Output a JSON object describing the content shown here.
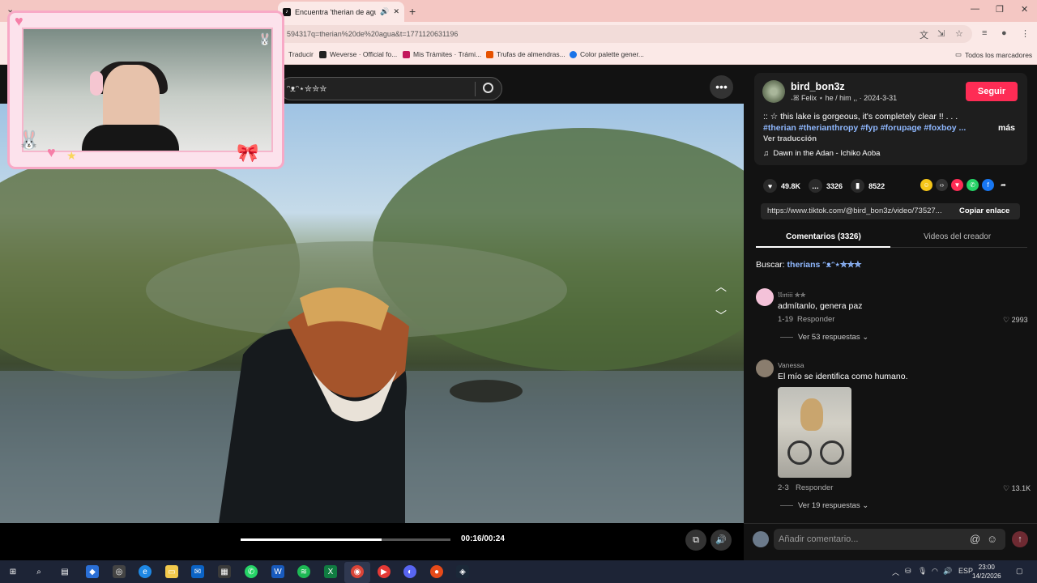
{
  "browser": {
    "active_tab_title": "Encuentra 'therian de agua'",
    "url": "594317q=therian%20de%20agua&t=1771120631196",
    "new_tab": "+",
    "bookmarks": [
      {
        "label": "Traducir",
        "color": "#4285f4"
      },
      {
        "label": "Weverse · Official fo...",
        "color": "#222222"
      },
      {
        "label": "Mis Trámites · Trámi...",
        "color": "#c2185b"
      },
      {
        "label": "Trufas de almendras...",
        "color": "#e65100"
      },
      {
        "label": "Color palette gener...",
        "color": "#1a73e8"
      }
    ],
    "bookmarks_all": "Todos los marcadores"
  },
  "tiktok": {
    "search_value": "ᵔᴥᵔ⋆✮✮✮",
    "video": {
      "time": "00:16/00:24",
      "progress_fraction": 0.67
    },
    "author": {
      "username": "bird_bon3z",
      "subtitle": "˖ꕤ Felix ⋆ he / him ,, · 2024-3-31",
      "follow_label": "Seguir",
      "description": ":: ☆ this lake is gorgeous, it's completely clear !! . . .",
      "hashtags": "#therian #therianthropy #fyp #forupage #foxboy ...",
      "more_label": "más",
      "translate_label": "Ver traducción",
      "music": "Dawn in the Adan - Ichiko Aoba"
    },
    "stats": {
      "likes": "49.8K",
      "comments": "3326",
      "saves": "8522"
    },
    "share_link": "https://www.tiktok.com/@bird_bon3z/video/73527...",
    "copy_link_label": "Copiar enlace",
    "tabs": {
      "comments": "Comentarios (3326)",
      "creator_videos": "Videos del creador"
    },
    "search_hint": {
      "prefix": "Buscar:",
      "term": "therians ᵔᴥᵔ⋆✮✮✮"
    },
    "comments": [
      {
        "user": "𝔘𝔪𝔦𝔦𝔦 ✮✮",
        "text": "admítanlo, genera paz",
        "date": "1-19",
        "reply": "Responder",
        "likes": "2993",
        "view_replies": "Ver 53 respuestas ⌄"
      },
      {
        "user": "Vanessa",
        "text": "El mío se identifica como humano.",
        "date": "2-3",
        "reply": "Responder",
        "likes": "13.1K",
        "view_replies": "Ver 19 respuestas ⌄"
      }
    ],
    "comment_placeholder": "Añadir comentario..."
  },
  "taskbar": {
    "lang": "ESP",
    "time": "23:00",
    "date": "14/2/2026"
  }
}
